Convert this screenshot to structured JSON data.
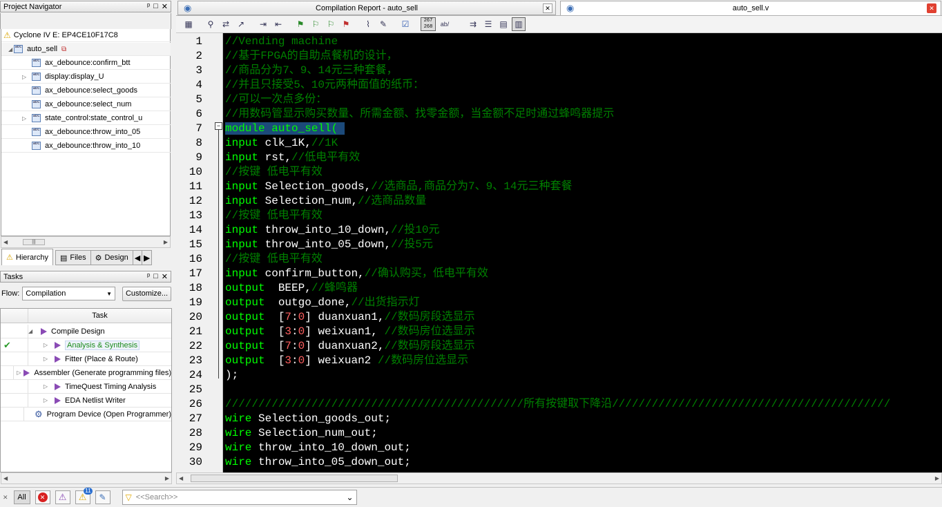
{
  "project_navigator": {
    "title": "Project Navigator",
    "pin": "ⵅ",
    "device": "Cyclone IV E: EP4CE10F17C8",
    "top_entity": "auto_sell",
    "items": [
      {
        "label": "ax_debounce:confirm_btt",
        "expandable": false
      },
      {
        "label": "display:display_U",
        "expandable": true
      },
      {
        "label": "ax_debounce:select_goods",
        "expandable": false
      },
      {
        "label": "ax_debounce:select_num",
        "expandable": false
      },
      {
        "label": "state_control:state_control_u",
        "expandable": true
      },
      {
        "label": "ax_debounce:throw_into_05",
        "expandable": false
      },
      {
        "label": "ax_debounce:throw_into_10",
        "expandable": false
      }
    ],
    "scroll_grip": "|||",
    "tabs": [
      "Hierarchy",
      "Files",
      "Design"
    ]
  },
  "tasks": {
    "title": "Tasks",
    "flow_label": "Flow:",
    "flow_value": "Compilation",
    "customize_label": "Customize...",
    "column_header": "Task",
    "rows": [
      {
        "label": "Compile Design",
        "level": 0,
        "status": "",
        "highlight": false
      },
      {
        "label": "Analysis & Synthesis",
        "level": 1,
        "status": "✔",
        "highlight": true
      },
      {
        "label": "Fitter (Place & Route)",
        "level": 1,
        "status": "",
        "highlight": false
      },
      {
        "label": "Assembler (Generate programming files)",
        "level": 1,
        "status": "",
        "highlight": false
      },
      {
        "label": "TimeQuest Timing Analysis",
        "level": 1,
        "status": "",
        "highlight": false
      },
      {
        "label": "EDA Netlist Writer",
        "level": 1,
        "status": "",
        "highlight": false
      },
      {
        "label": "Program Device (Open Programmer)",
        "level": 0,
        "status": "",
        "highlight": false
      }
    ]
  },
  "editor": {
    "tab_report": "Compilation Report - auto_sell",
    "tab_file": "auto_sell.v",
    "close_glyph": "✕",
    "line_number_badge_top": "267",
    "line_number_badge_bottom": "268",
    "ab_badge": "ab/",
    "lines": [
      [
        [
          "cm",
          "//Vending machine"
        ]
      ],
      [
        [
          "cm",
          "//基于FPGA的自助点餐机的设计，"
        ]
      ],
      [
        [
          "cm",
          "//商品分为7、9、14元三种套餐，"
        ]
      ],
      [
        [
          "cm",
          "//并且只接受5、10元两种面值的纸币："
        ]
      ],
      [
        [
          "cm",
          "//可以一次点多份："
        ]
      ],
      [
        [
          "cm",
          "//用数码管显示购买数量、所需金额、找零金额，当金额不足时通过蜂鸣器提示"
        ]
      ],
      [
        [
          "hl",
          "module auto_sell( "
        ]
      ],
      [
        [
          "kw",
          "input"
        ],
        [
          "br",
          " clk_1K,"
        ],
        [
          "cm",
          "//1K"
        ]
      ],
      [
        [
          "kw",
          "input"
        ],
        [
          "br",
          " rst,"
        ],
        [
          "cm",
          "//低电平有效"
        ]
      ],
      [
        [
          "cm",
          "//按键 低电平有效"
        ]
      ],
      [
        [
          "kw",
          "input"
        ],
        [
          "br",
          " Selection_goods,"
        ],
        [
          "cm",
          "//选商品,商品分为7、9、14元三种套餐"
        ]
      ],
      [
        [
          "kw",
          "input"
        ],
        [
          "br",
          " Selection_num,"
        ],
        [
          "cm",
          "//选商品数量"
        ]
      ],
      [
        [
          "cm",
          "//按键 低电平有效"
        ]
      ],
      [
        [
          "kw",
          "input"
        ],
        [
          "br",
          " throw_into_10_down,"
        ],
        [
          "cm",
          "//投10元"
        ]
      ],
      [
        [
          "kw",
          "input"
        ],
        [
          "br",
          " throw_into_05_down,"
        ],
        [
          "cm",
          "//投5元"
        ]
      ],
      [
        [
          "cm",
          "//按键 低电平有效"
        ]
      ],
      [
        [
          "kw",
          "input"
        ],
        [
          "br",
          " confirm_button,"
        ],
        [
          "cm",
          "//确认购买，低电平有效"
        ]
      ],
      [
        [
          "kw",
          "output"
        ],
        [
          "br",
          "  BEEP,"
        ],
        [
          "cm",
          "//蜂鸣器"
        ]
      ],
      [
        [
          "kw",
          "output"
        ],
        [
          "br",
          "  outgo_done,"
        ],
        [
          "cm",
          "//出货指示灯"
        ]
      ],
      [
        [
          "kw",
          "output"
        ],
        [
          "br",
          "  ["
        ],
        [
          "num",
          "7"
        ],
        [
          "br",
          ":"
        ],
        [
          "num",
          "0"
        ],
        [
          "br",
          "] duanxuan1,"
        ],
        [
          "cm",
          "//数码房段选显示"
        ]
      ],
      [
        [
          "kw",
          "output"
        ],
        [
          "br",
          "  ["
        ],
        [
          "num",
          "3"
        ],
        [
          "br",
          ":"
        ],
        [
          "num",
          "0"
        ],
        [
          "br",
          "] weixuan1, "
        ],
        [
          "cm",
          "//数码房位选显示"
        ]
      ],
      [
        [
          "kw",
          "output"
        ],
        [
          "br",
          "  ["
        ],
        [
          "num",
          "7"
        ],
        [
          "br",
          ":"
        ],
        [
          "num",
          "0"
        ],
        [
          "br",
          "] duanxuan2,"
        ],
        [
          "cm",
          "//数码房段选显示"
        ]
      ],
      [
        [
          "kw",
          "output"
        ],
        [
          "br",
          "  ["
        ],
        [
          "num",
          "3"
        ],
        [
          "br",
          ":"
        ],
        [
          "num",
          "0"
        ],
        [
          "br",
          "] weixuan2 "
        ],
        [
          "cm",
          "//数码房位选显示"
        ]
      ],
      [
        [
          "br",
          ");"
        ]
      ],
      [
        [
          "br",
          ""
        ]
      ],
      [
        [
          "cm",
          "/////////////////////////////////////////////所有按键取下降沿//////////////////////////////////////////"
        ]
      ],
      [
        [
          "kw",
          "wire"
        ],
        [
          "br",
          " Selection_goods_out;"
        ]
      ],
      [
        [
          "kw",
          "wire"
        ],
        [
          "br",
          " Selection_num_out;"
        ]
      ],
      [
        [
          "kw",
          "wire"
        ],
        [
          "br",
          " throw_into_10_down_out;"
        ]
      ],
      [
        [
          "kw",
          "wire"
        ],
        [
          "br",
          " throw_into_05_down_out;"
        ]
      ]
    ]
  },
  "messages": {
    "all_label": "All",
    "warning_count": "11",
    "search_placeholder": "<<Search>>"
  },
  "colors": {
    "editor_bg": "#000000",
    "keyword": "#00ff00",
    "comment": "#008000",
    "number": "#ff6060",
    "selection": "#1c4a7a"
  }
}
